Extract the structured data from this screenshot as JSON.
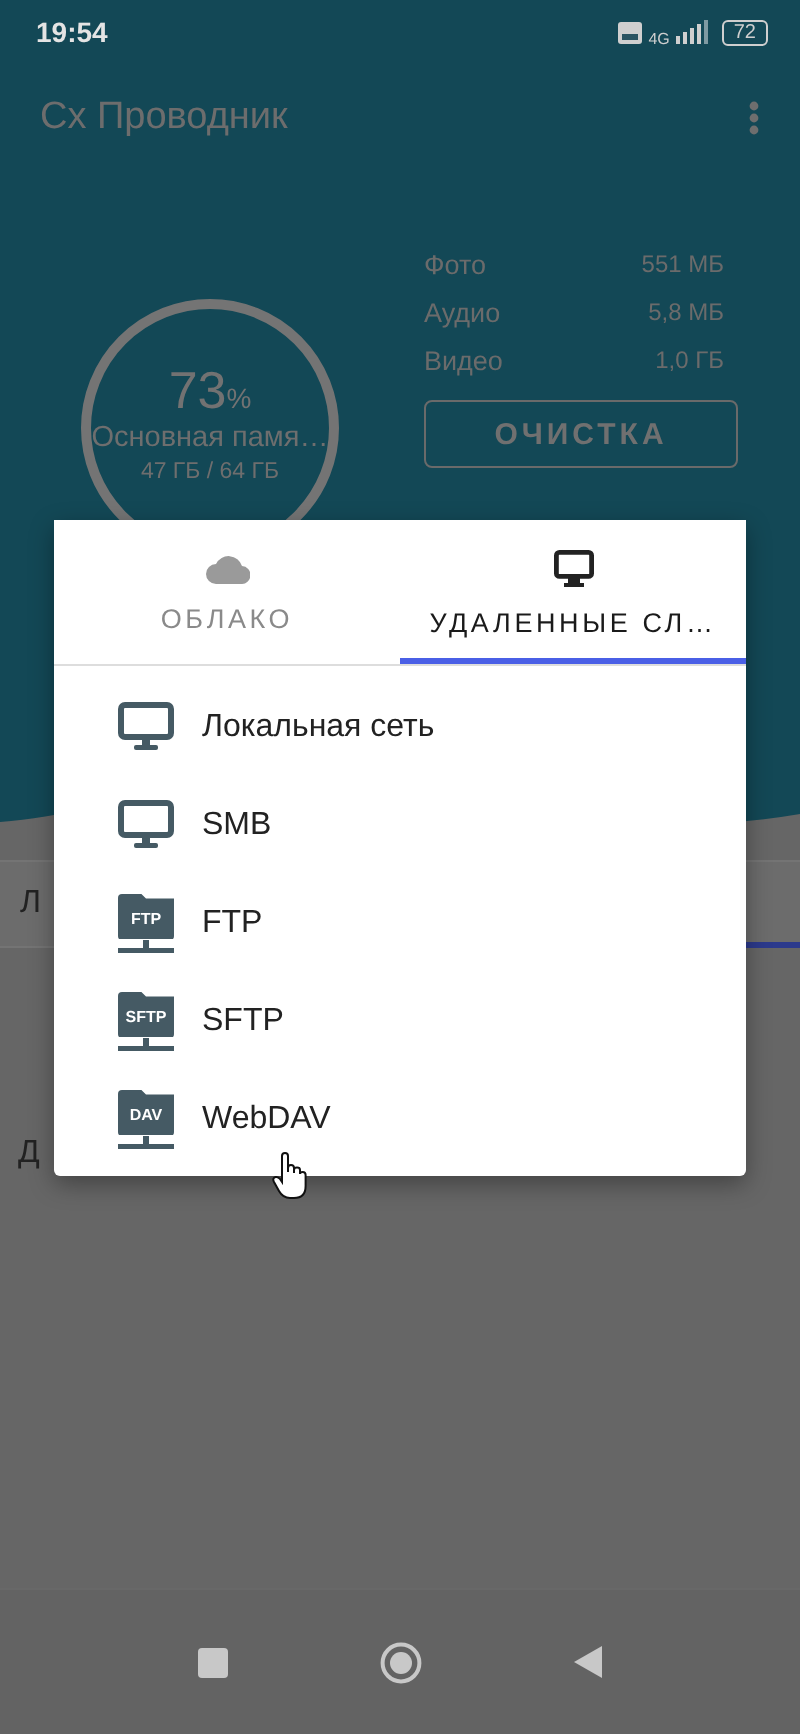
{
  "status_bar": {
    "time": "19:54",
    "network": "4G",
    "battery": "72"
  },
  "app_bar": {
    "title": "Cx Проводник"
  },
  "storage": {
    "percent": "73",
    "unit": "%",
    "name": "Основная памя…",
    "usage": "47 ГБ / 64 ГБ",
    "categories": [
      {
        "label": "Фото",
        "size": "551 МБ"
      },
      {
        "label": "Аудио",
        "size": "5,8 МБ"
      },
      {
        "label": "Видео",
        "size": "1,0 ГБ"
      }
    ],
    "clean_button": "ОЧИСТКА"
  },
  "background_fragments": [
    "Л",
    "Д"
  ],
  "dialog": {
    "tabs": [
      {
        "label": "ОБЛАКО",
        "kind": "cloud",
        "selected": false
      },
      {
        "label": "УДАЛЕННЫЕ СЛ…",
        "kind": "monitor",
        "selected": true
      }
    ],
    "items": [
      {
        "kind": "monitor",
        "label": "Локальная сеть"
      },
      {
        "kind": "monitor",
        "label": "SMB"
      },
      {
        "kind": "folder",
        "badge": "FTP",
        "label": "FTP"
      },
      {
        "kind": "folder",
        "badge": "SFTP",
        "label": "SFTP"
      },
      {
        "kind": "folder",
        "badge": "DAV",
        "label": "WebDAV"
      }
    ]
  }
}
